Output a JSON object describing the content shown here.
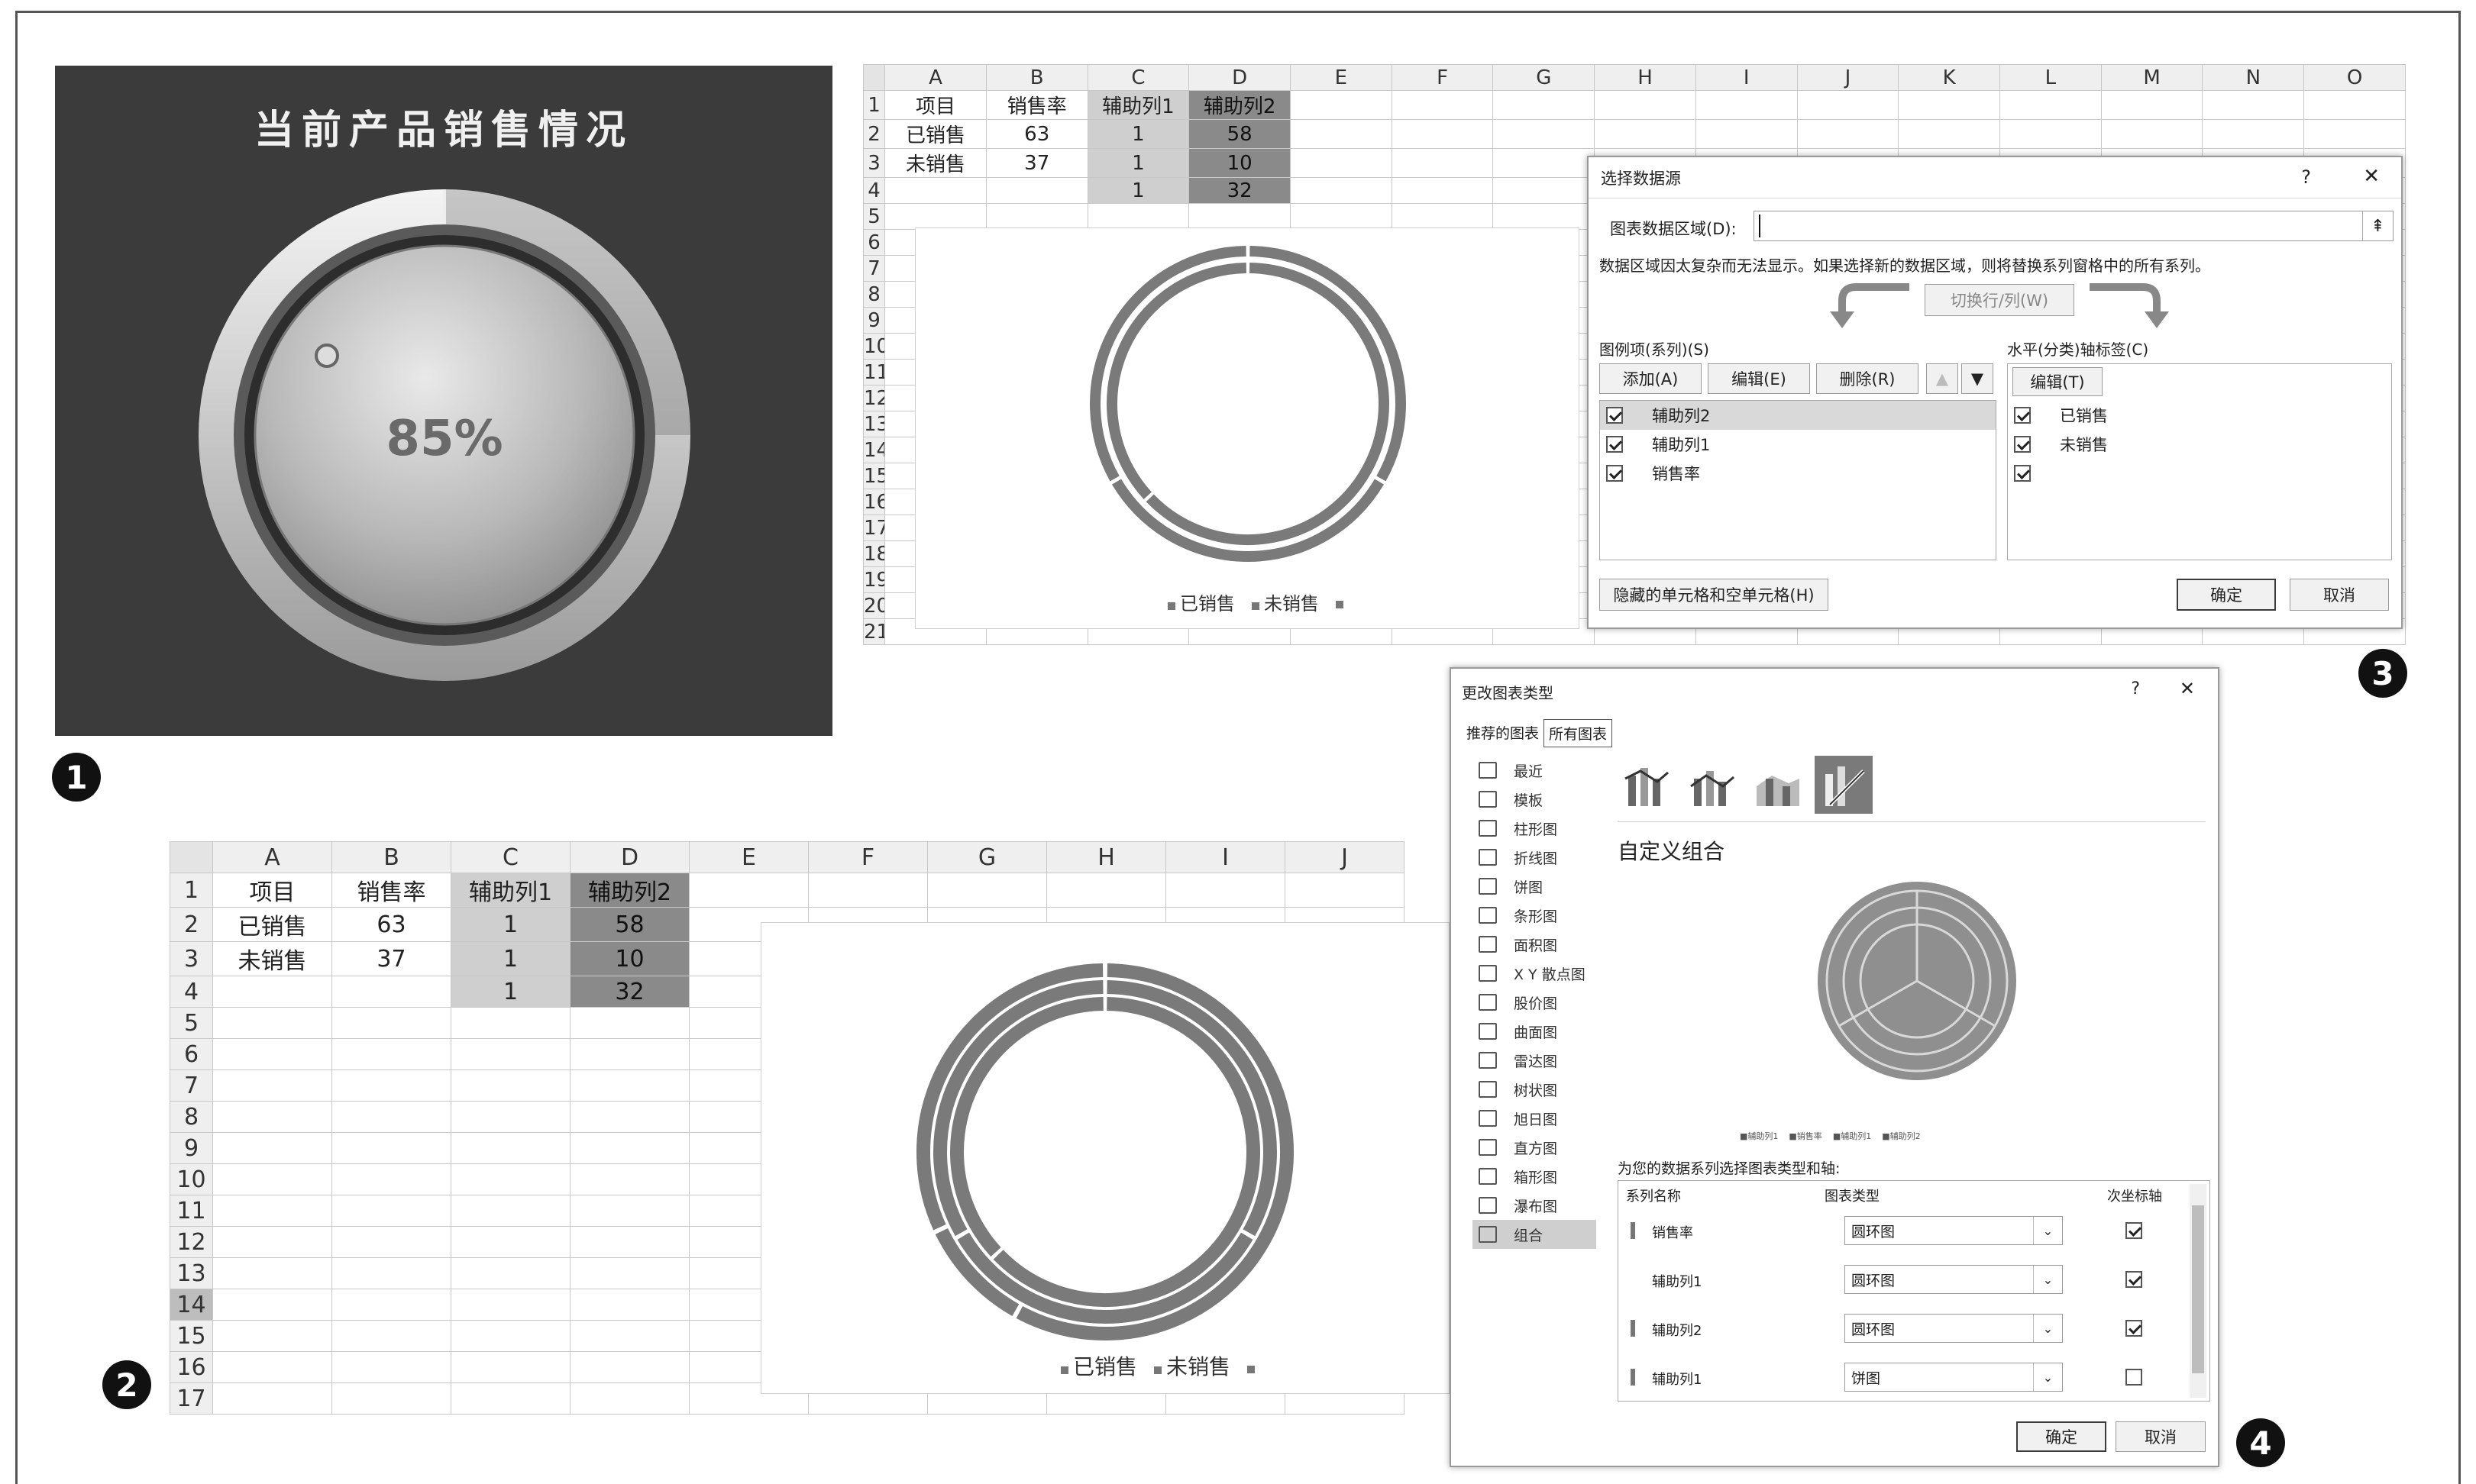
{
  "gauge": {
    "title": "当前产品销售情况",
    "value": "85%"
  },
  "sheet": {
    "columns": [
      "A",
      "B",
      "C",
      "D",
      "E",
      "F",
      "G",
      "H",
      "I",
      "J",
      "K",
      "L",
      "M",
      "N",
      "O"
    ],
    "rows": [
      {
        "n": "1",
        "a": "项目",
        "b": "销售率",
        "c": "辅助列1",
        "d": "辅助列2"
      },
      {
        "n": "2",
        "a": "已销售",
        "b": "63",
        "c": "1",
        "d": "58"
      },
      {
        "n": "3",
        "a": "未销售",
        "b": "37",
        "c": "1",
        "d": "10"
      },
      {
        "n": "4",
        "a": "",
        "b": "",
        "c": "1",
        "d": "32"
      }
    ],
    "row_numbers_top": [
      "1",
      "2",
      "3",
      "4",
      "5",
      "6",
      "7",
      "8",
      "9",
      "10",
      "11",
      "12",
      "13",
      "14",
      "15",
      "16",
      "17",
      "18",
      "19",
      "20",
      "21"
    ],
    "row_numbers_bottom": [
      "1",
      "2",
      "3",
      "4",
      "5",
      "6",
      "7",
      "8",
      "9",
      "10",
      "11",
      "12",
      "13",
      "14",
      "15",
      "16",
      "17"
    ]
  },
  "chart_data": {
    "type": "doughnut",
    "rings": [
      {
        "name": "销售率",
        "values": [
          63,
          37
        ]
      },
      {
        "name": "辅助列1",
        "values": [
          1,
          1,
          1
        ]
      },
      {
        "name": "辅助列2",
        "values": [
          58,
          10,
          32
        ]
      }
    ],
    "categories": [
      "已销售",
      "未销售"
    ],
    "legend": [
      "已销售",
      "未销售"
    ]
  },
  "select_source_dialog": {
    "title": "选择数据源",
    "help": "?",
    "close": "✕",
    "range_label": "图表数据区域(D):",
    "range_value": "",
    "message": "数据区域因太复杂而无法显示。如果选择新的数据区域，则将替换系列窗格中的所有系列。",
    "switch_btn": "切换行/列(W)",
    "legend_title": "图例项(系列)(S)",
    "add_btn": "添加(A)",
    "edit_btn": "编辑(E)",
    "delete_btn": "删除(R)",
    "up": "▲",
    "down": "▼",
    "series": [
      "辅助列2",
      "辅助列1",
      "销售率"
    ],
    "axis_title": "水平(分类)轴标签(C)",
    "axis_edit_btn": "编辑(T)",
    "axis_labels": [
      "已销售",
      "未销售",
      ""
    ],
    "hidden_btn": "隐藏的单元格和空单元格(H)",
    "ok": "确定",
    "cancel": "取消"
  },
  "change_type_dialog": {
    "title": "更改图表类型",
    "help": "?",
    "close": "✕",
    "tabs": [
      "推荐的图表",
      "所有图表"
    ],
    "nav": [
      "最近",
      "模板",
      "柱形图",
      "折线图",
      "饼图",
      "条形图",
      "面积图",
      "X Y 散点图",
      "股价图",
      "曲面图",
      "雷达图",
      "树状图",
      "旭日图",
      "直方图",
      "箱形图",
      "瀑布图",
      "组合"
    ],
    "combo_title": "自定义组合",
    "preview_legend": [
      "■辅助列1",
      "■销售率",
      "■辅助列1",
      "■辅助列2"
    ],
    "instruction": "为您的数据系列选择图表类型和轴:",
    "headers": [
      "系列名称",
      "图表类型",
      "次坐标轴"
    ],
    "rows": [
      {
        "name": "销售率",
        "type": "圆环图",
        "secondary": true
      },
      {
        "name": "辅助列1",
        "type": "圆环图",
        "secondary": true
      },
      {
        "name": "辅助列2",
        "type": "圆环图",
        "secondary": true
      },
      {
        "name": "辅助列1",
        "type": "饼图",
        "secondary": false
      }
    ],
    "ok": "确定",
    "cancel": "取消"
  },
  "badges": [
    "1",
    "2",
    "3",
    "4"
  ],
  "colors": {
    "panel_dark": "#3b3b3b",
    "gauge_silver": "#bfbfbf",
    "ring_gray": "#7a7a7a"
  }
}
